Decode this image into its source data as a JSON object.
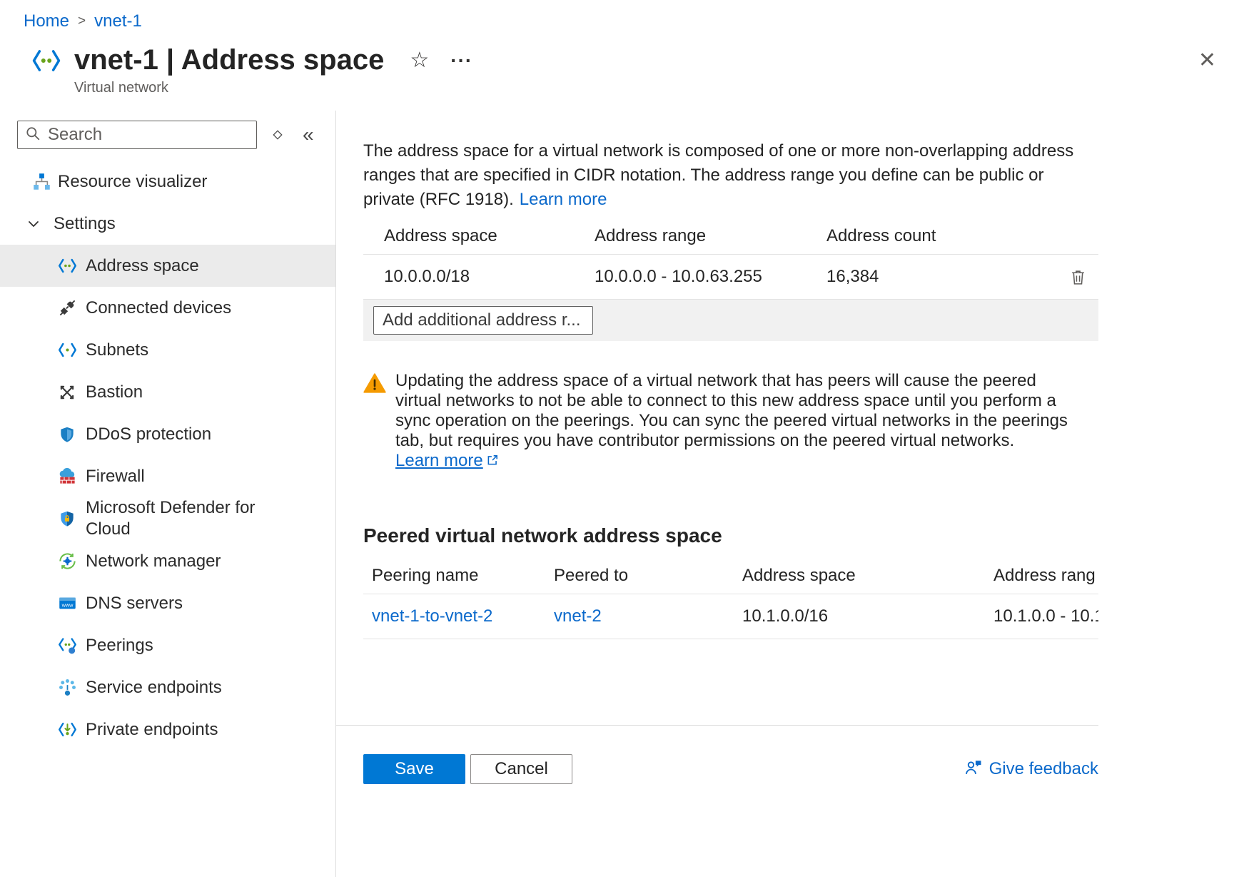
{
  "breadcrumb": {
    "items": [
      "Home",
      "vnet-1"
    ],
    "separator": ">"
  },
  "header": {
    "title": "vnet-1 | Address space",
    "subtitle": "Virtual network",
    "star_glyph": "☆",
    "more_glyph": "···",
    "close_glyph": "✕"
  },
  "sidebar": {
    "search_placeholder": "Search",
    "collapse_glyph": "«",
    "resource_visualizer": "Resource visualizer",
    "settings_label": "Settings",
    "items": [
      {
        "label": "Address space"
      },
      {
        "label": "Connected devices"
      },
      {
        "label": "Subnets"
      },
      {
        "label": "Bastion"
      },
      {
        "label": "DDoS protection"
      },
      {
        "label": "Firewall"
      },
      {
        "label": "Microsoft Defender for Cloud"
      },
      {
        "label": "Network manager"
      },
      {
        "label": "DNS servers"
      },
      {
        "label": "Peerings"
      },
      {
        "label": "Service endpoints"
      },
      {
        "label": "Private endpoints"
      }
    ]
  },
  "main": {
    "intro": "The address space for a virtual network is composed of one or more non-overlapping address ranges that are specified in CIDR notation. The address range you define can be public or private (RFC 1918).",
    "intro_link": "Learn more",
    "address_table": {
      "headers": [
        "Address space",
        "Address range",
        "Address count"
      ],
      "row": {
        "space": "10.0.0.0/18",
        "range": "10.0.0.0 - 10.0.63.255",
        "count": "16,384"
      },
      "add_placeholder": "Add additional address r..."
    },
    "warning": {
      "text": "Updating the address space of a virtual network that has peers will cause the peered virtual networks to not be able to connect to this new address space until you perform a sync operation on the peerings. You can sync the peered virtual networks in the peerings tab, but requires you have contributor permissions on the peered virtual networks.",
      "link": "Learn more"
    },
    "peered": {
      "title": "Peered virtual network address space",
      "headers": [
        "Peering name",
        "Peered to",
        "Address space",
        "Address rang"
      ],
      "row": {
        "name": "vnet-1-to-vnet-2",
        "peered_to": "vnet-2",
        "space": "10.1.0.0/16",
        "range": "10.1.0.0 - 10.1"
      }
    },
    "footer": {
      "save": "Save",
      "cancel": "Cancel",
      "feedback": "Give feedback"
    }
  }
}
